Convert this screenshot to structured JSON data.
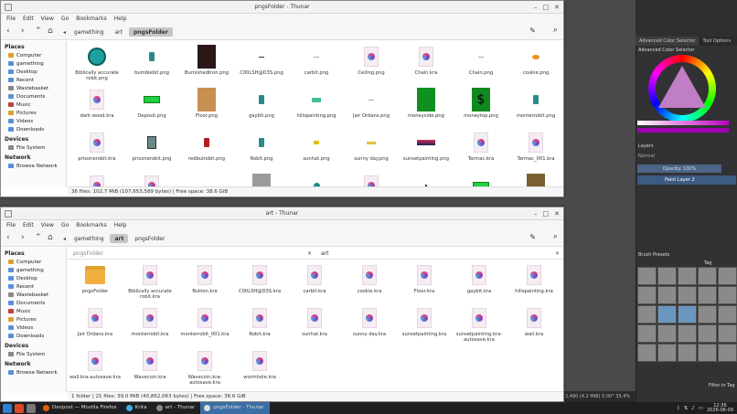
{
  "krita": {
    "dock_tabs": [
      "Advanced Color Selector",
      "Tool Options"
    ],
    "color_selector_title": "Advanced Color Selector",
    "layers_title": "Layers",
    "blend_mode": "Normal",
    "opacity": "Opacity: 100%",
    "layer_name": "Paint Layer 2",
    "brush_presets_title": "Brush Presets",
    "brush_tag": "Tag",
    "filter_label": "Filter in Tag",
    "status": "2,480 (4.2 MiB)   0.00°   35.4%"
  },
  "win1": {
    "title": "pngsFolder - Thunar",
    "menu": [
      "File",
      "Edit",
      "View",
      "Go",
      "Bookmarks",
      "Help"
    ],
    "crumbs": [
      "gamething",
      "art",
      "pngsFolder"
    ],
    "sidebar": {
      "places_label": "Places",
      "places": [
        "Computer",
        "gamething",
        "Desktop",
        "Recent",
        "Wastebasket",
        "Documents",
        "Music",
        "Pictures",
        "Videos",
        "Downloads"
      ],
      "devices_label": "Devices",
      "devices": [
        "File System"
      ],
      "network_label": "Network",
      "network": [
        "Browse Network"
      ]
    },
    "files": [
      {
        "name": "Biblically accurate robit.png",
        "thumb": "robot-teal"
      },
      {
        "name": "bumblebit.png",
        "thumb": "robot-small"
      },
      {
        "name": "Burnishedtron.png",
        "thumb": "dark"
      },
      {
        "name": "C00LSH@D3S.png",
        "thumb": "dash"
      },
      {
        "name": "carbit.png",
        "thumb": "dash-gray"
      },
      {
        "name": "Ceiling.png",
        "thumb": "kra"
      },
      {
        "name": "Chain.kra",
        "thumb": "kra"
      },
      {
        "name": "Chain.png",
        "thumb": "dash-gray"
      },
      {
        "name": "cookie.png",
        "thumb": "cookie"
      },
      {
        "name": "dark wood.kra",
        "thumb": "kra"
      },
      {
        "name": "Deposit.png",
        "thumb": "green-bar"
      },
      {
        "name": "Floor.png",
        "thumb": "wood"
      },
      {
        "name": "gaybit.png",
        "thumb": "robot-small"
      },
      {
        "name": "hillspainting.png",
        "thumb": "teal-bar"
      },
      {
        "name": "Jair Ordans.png",
        "thumb": "dash-gray"
      },
      {
        "name": "moneyside.png",
        "thumb": "green-sq"
      },
      {
        "name": "moneytop.png",
        "thumb": "dollar"
      },
      {
        "name": "monterrobit.png",
        "thumb": "robot-small"
      },
      {
        "name": "prisonerobit.kra",
        "thumb": "kra"
      },
      {
        "name": "prisonerobit.png",
        "thumb": "robot-gray"
      },
      {
        "name": "redbulrobit.png",
        "thumb": "robot-red"
      },
      {
        "name": "Robit.png",
        "thumb": "robot-small"
      },
      {
        "name": "sunhat.png",
        "thumb": "yellow"
      },
      {
        "name": "sunny day.png",
        "thumb": "yellow-bar"
      },
      {
        "name": "sunsetpainting.png",
        "thumb": "sunset"
      },
      {
        "name": "Tarmac.kra",
        "thumb": "kra"
      },
      {
        "name": "Tarmac_001.kra",
        "thumb": "kra"
      },
      {
        "name": "",
        "thumb": "kra"
      },
      {
        "name": "",
        "thumb": "kra"
      },
      {
        "name": "",
        "thumb": "none"
      },
      {
        "name": "",
        "thumb": "gray"
      },
      {
        "name": "",
        "thumb": "coin"
      },
      {
        "name": "",
        "thumb": "kra"
      },
      {
        "name": "",
        "thumb": "dot"
      },
      {
        "name": "",
        "thumb": "green-bar2"
      },
      {
        "name": "",
        "thumb": "olive"
      },
      {
        "name": "",
        "thumb": "purple"
      }
    ],
    "status": "36 files: 102.7 MiB (107,653,589 bytes)  |  Free space: 38.6 GiB"
  },
  "win2": {
    "title": "art - Thunar",
    "menu": [
      "File",
      "Edit",
      "View",
      "Go",
      "Bookmarks",
      "Help"
    ],
    "crumbs": [
      "gamething",
      "art",
      "pngsFolder"
    ],
    "split_left_label": "pngsFolder",
    "split_right_label": "art",
    "files": [
      {
        "name": "pngsFolder",
        "thumb": "folder"
      },
      {
        "name": "Biblically accurate robit.kra",
        "thumb": "kra"
      },
      {
        "name": "Button.kra",
        "thumb": "kra"
      },
      {
        "name": "C00LSH@D3S.kra",
        "thumb": "kra"
      },
      {
        "name": "carbit.kra",
        "thumb": "kra"
      },
      {
        "name": "cookie.kra",
        "thumb": "kra"
      },
      {
        "name": "Floor.kra",
        "thumb": "kra"
      },
      {
        "name": "gaybit.kra",
        "thumb": "kra"
      },
      {
        "name": "hillspainting.kra",
        "thumb": "kra"
      },
      {
        "name": "Jair Ordans.kra",
        "thumb": "kra"
      },
      {
        "name": "monterrobit.kra",
        "thumb": "kra"
      },
      {
        "name": "monterrobit_001.kra",
        "thumb": "kra"
      },
      {
        "name": "Robit.kra",
        "thumb": "kra"
      },
      {
        "name": "sunhat.kra",
        "thumb": "kra"
      },
      {
        "name": "sunny day.kra",
        "thumb": "kra"
      },
      {
        "name": "sunsetpainting.kra",
        "thumb": "kra"
      },
      {
        "name": "sunsetpainting.kra-autosave.kra",
        "thumb": "kra"
      },
      {
        "name": "wall.kra",
        "thumb": "kra"
      },
      {
        "name": "wall.kra-autosave.kra",
        "thumb": "kra"
      },
      {
        "name": "Wavecoin.kra",
        "thumb": "kra"
      },
      {
        "name": "Wavecoin.kra-autosave.kra",
        "thumb": "kra"
      },
      {
        "name": "wormhole.kra",
        "thumb": "kra"
      }
    ],
    "status": "1 folder  |  21 files: 39.0 MiB (40,862,063 bytes)  |  Free space: 38.6 GiB"
  },
  "taskbar": {
    "tasks": [
      "Devpost — Mozilla Firefox",
      "Krita",
      "art - Thunar",
      "pngsFolder - Thunar"
    ],
    "active_task": 3,
    "time": "12:36",
    "date": "2026-06-09"
  }
}
